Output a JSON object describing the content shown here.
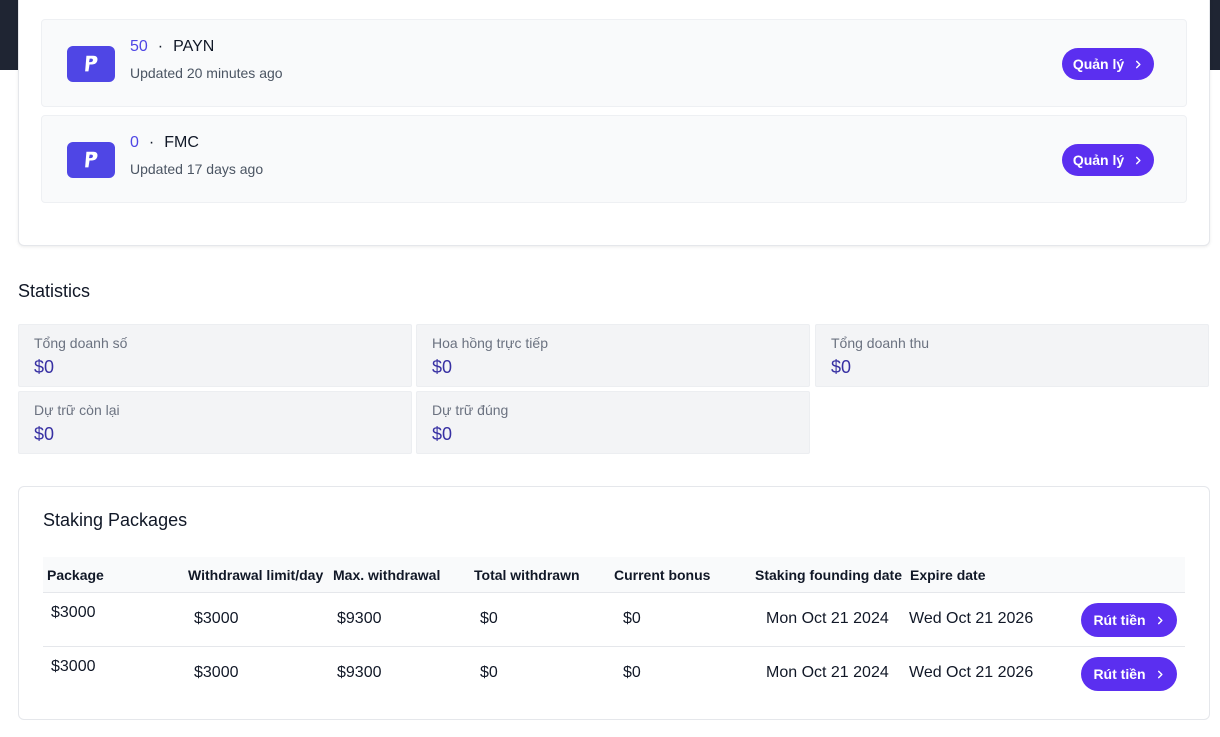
{
  "tokens": [
    {
      "amount": "50",
      "separator": "·",
      "symbol": "PAYN",
      "updated": "Updated 20 minutes ago",
      "button": "Quản lý",
      "logo_icon": "paypal-p-icon"
    },
    {
      "amount": "0",
      "separator": "·",
      "symbol": "FMC",
      "updated": "Updated 17 days ago",
      "button": "Quản lý",
      "logo_icon": "paypal-p-icon"
    }
  ],
  "statistics": {
    "heading": "Statistics",
    "items": [
      {
        "label": "Tổng doanh số",
        "value": "$0"
      },
      {
        "label": "Hoa hồng trực tiếp",
        "value": "$0"
      },
      {
        "label": "Tổng doanh thu",
        "value": "$0"
      },
      {
        "label": "Dự trữ còn lại",
        "value": "$0"
      },
      {
        "label": "Dự trữ đúng",
        "value": "$0"
      }
    ]
  },
  "staking": {
    "title": "Staking Packages",
    "columns": [
      "Package",
      "Withdrawal limit/day",
      "Max. withdrawal",
      "Total withdrawn",
      "Current bonus",
      "Staking founding date",
      "Expire date"
    ],
    "rows": [
      {
        "package": "$3000",
        "limit": "$3000",
        "max": "$9300",
        "withdrawn": "$0",
        "bonus": "$0",
        "founded": "Mon Oct 21 2024",
        "expire": "Wed Oct 21 2026",
        "action": "Rút tiền"
      },
      {
        "package": "$3000",
        "limit": "$3000",
        "max": "$9300",
        "withdrawn": "$0",
        "bonus": "$0",
        "founded": "Mon Oct 21 2024",
        "expire": "Wed Oct 21 2026",
        "action": "Rút tiền"
      }
    ]
  },
  "colors": {
    "accent": "#5b2ff0",
    "amount": "#4f46e5",
    "stat_value": "#3730a3",
    "header_band": "#1f2533"
  }
}
